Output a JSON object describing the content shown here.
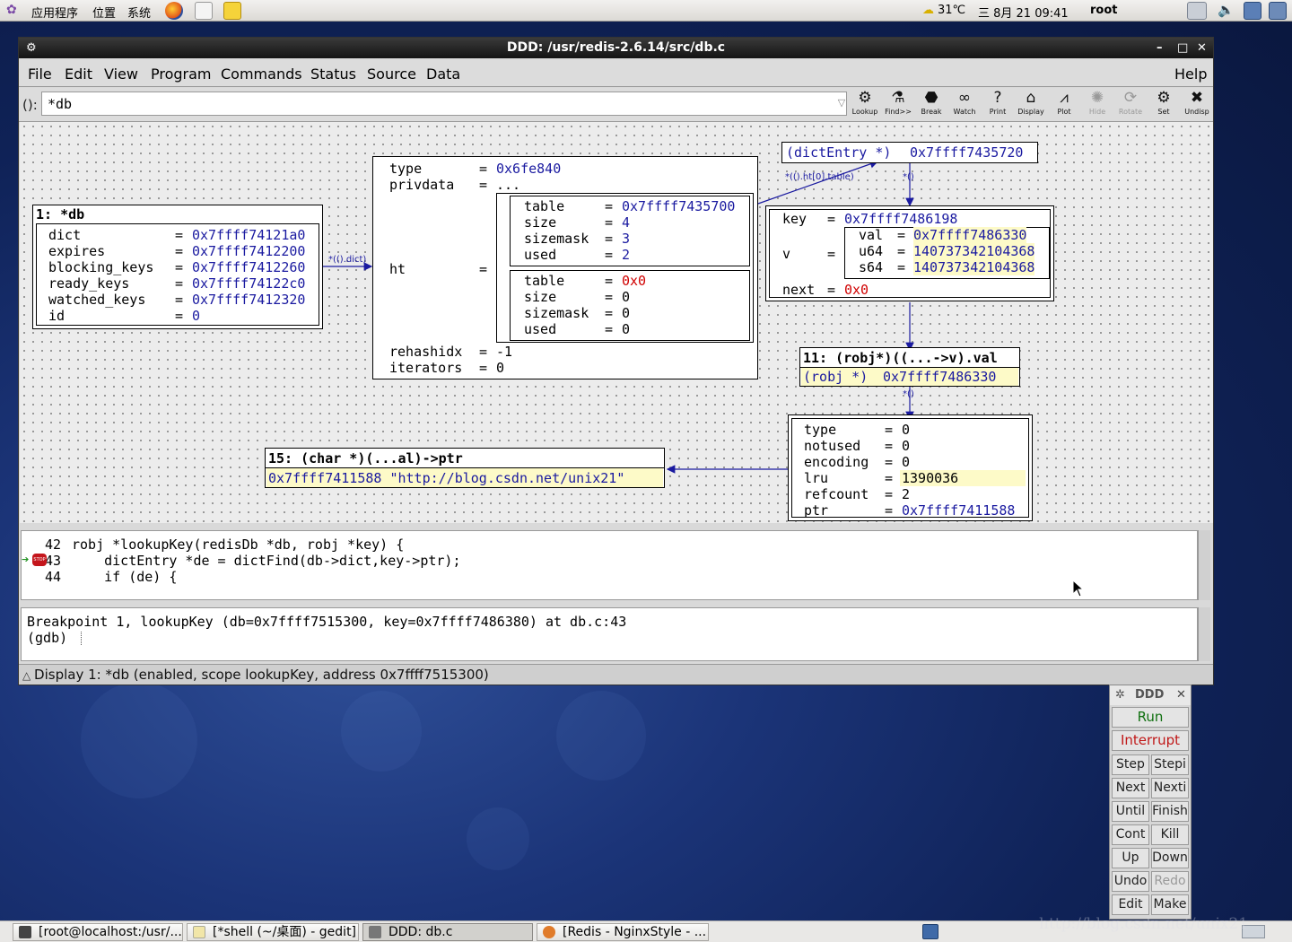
{
  "top_panel": {
    "applications": "应用程序",
    "places": "位置",
    "system": "系统",
    "weather": "31℃",
    "datetime": "三 8月 21 09:41",
    "user": "root"
  },
  "window": {
    "title": "DDD: /usr/redis-2.6.14/src/db.c"
  },
  "menu": {
    "file": "File",
    "edit": "Edit",
    "view": "View",
    "program": "Program",
    "commands": "Commands",
    "status": "Status",
    "source": "Source",
    "data": "Data",
    "help": "Help"
  },
  "arg": {
    "label": "():",
    "value": "*db"
  },
  "toolbar": [
    {
      "label": "Lookup",
      "icon": "lookup-icon",
      "enabled": true
    },
    {
      "label": "Find>>",
      "icon": "find-icon",
      "enabled": true
    },
    {
      "label": "Break",
      "icon": "stop-icon",
      "enabled": true
    },
    {
      "label": "Watch",
      "icon": "glasses-icon",
      "enabled": true
    },
    {
      "label": "Print",
      "icon": "question-icon",
      "enabled": true
    },
    {
      "label": "Display",
      "icon": "display-icon",
      "enabled": true
    },
    {
      "label": "Plot",
      "icon": "plot-icon",
      "enabled": true
    },
    {
      "label": "Hide",
      "icon": "hide-icon",
      "enabled": false
    },
    {
      "label": "Rotate",
      "icon": "rotate-icon",
      "enabled": false
    },
    {
      "label": "Set",
      "icon": "set-icon",
      "enabled": true
    },
    {
      "label": "Undisp",
      "icon": "undisp-icon",
      "enabled": true
    }
  ],
  "displays": {
    "db": {
      "title": "1: *db",
      "fields": [
        {
          "name": "dict",
          "value": "0x7ffff74121a0"
        },
        {
          "name": "expires",
          "value": "0x7ffff7412200"
        },
        {
          "name": "blocking_keys",
          "value": "0x7ffff7412260"
        },
        {
          "name": "ready_keys",
          "value": "0x7ffff74122c0"
        },
        {
          "name": "watched_keys",
          "value": "0x7ffff7412320"
        },
        {
          "name": "id",
          "value": "0"
        }
      ]
    },
    "dict": {
      "type_label": "type",
      "type_value": "0x6fe840",
      "privdata_label": "privdata",
      "privdata_value": "...",
      "ht_label": "ht",
      "ht0": [
        {
          "name": "table",
          "value": "0x7ffff7435700"
        },
        {
          "name": "size",
          "value": "4"
        },
        {
          "name": "sizemask",
          "value": "3"
        },
        {
          "name": "used",
          "value": "2"
        }
      ],
      "ht1": [
        {
          "name": "table",
          "value": "0x0"
        },
        {
          "name": "size",
          "value": "0"
        },
        {
          "name": "sizemask",
          "value": "0"
        },
        {
          "name": "used",
          "value": "0"
        }
      ],
      "rehashidx_label": "rehashidx",
      "rehashidx_value": "-1",
      "iterators_label": "iterators",
      "iterators_value": "0"
    },
    "dictentry_ptr": {
      "type": "(dictEntry *)",
      "value": "0x7ffff7435720"
    },
    "dictentry": {
      "key_label": "key",
      "key_value": "0x7ffff7486198",
      "v_label": "v",
      "v": [
        {
          "name": "val",
          "value": "0x7ffff7486330"
        },
        {
          "name": "u64",
          "value": "140737342104368"
        },
        {
          "name": "s64",
          "value": "140737342104368"
        }
      ],
      "next_label": "next",
      "next_value": "0x0"
    },
    "robj_ptr": {
      "title": "11: (robj*)((...->v).val",
      "type": "(robj *)",
      "value": "0x7ffff7486330"
    },
    "robj": [
      {
        "name": "type",
        "value": "0"
      },
      {
        "name": "notused",
        "value": "0"
      },
      {
        "name": "encoding",
        "value": "0"
      },
      {
        "name": "lru",
        "value": "1390036"
      },
      {
        "name": "refcount",
        "value": "2"
      },
      {
        "name": "ptr",
        "value": "0x7ffff7411588"
      }
    ],
    "str": {
      "title": "15: (char *)(...al)->ptr",
      "value": "0x7ffff7411588 \"http://blog.csdn.net/unix21\""
    }
  },
  "edges": {
    "dict": "*(().dict)",
    "table": "*(().ht[0].table)",
    "deref1": "*()",
    "deref2": "*()"
  },
  "source_lines": [
    {
      "num": "42",
      "code": "robj *lookupKey(redisDb *db, robj *key) {"
    },
    {
      "num": "43",
      "code": "    dictEntry *de = dictFind(db->dict,key->ptr);"
    },
    {
      "num": "44",
      "code": "    if (de) {"
    }
  ],
  "stop_badge": "STOP",
  "gdb_console": [
    "Breakpoint 1, lookupKey (db=0x7ffff7515300, key=0x7ffff7486380) at db.c:43",
    "(gdb) "
  ],
  "status": "Display 1: *db (enabled, scope lookupKey, address 0x7ffff7515300)",
  "command_tool": {
    "title": "DDD",
    "run": "Run",
    "interrupt": "Interrupt",
    "step": "Step",
    "stepi": "Stepi",
    "next": "Next",
    "nexti": "Nexti",
    "until": "Until",
    "finish": "Finish",
    "cont": "Cont",
    "kill": "Kill",
    "up": "Up",
    "down": "Down",
    "undo": "Undo",
    "redo": "Redo",
    "edit": "Edit",
    "make": "Make"
  },
  "taskbar": [
    {
      "label": "[root@localhost:/usr/..."
    },
    {
      "label": "[*shell (~/桌面) - gedit]"
    },
    {
      "label": "DDD: db.c"
    },
    {
      "label": "[Redis - NginxStyle - ..."
    }
  ],
  "watermark": "http://blog.csdn.net/unix21"
}
